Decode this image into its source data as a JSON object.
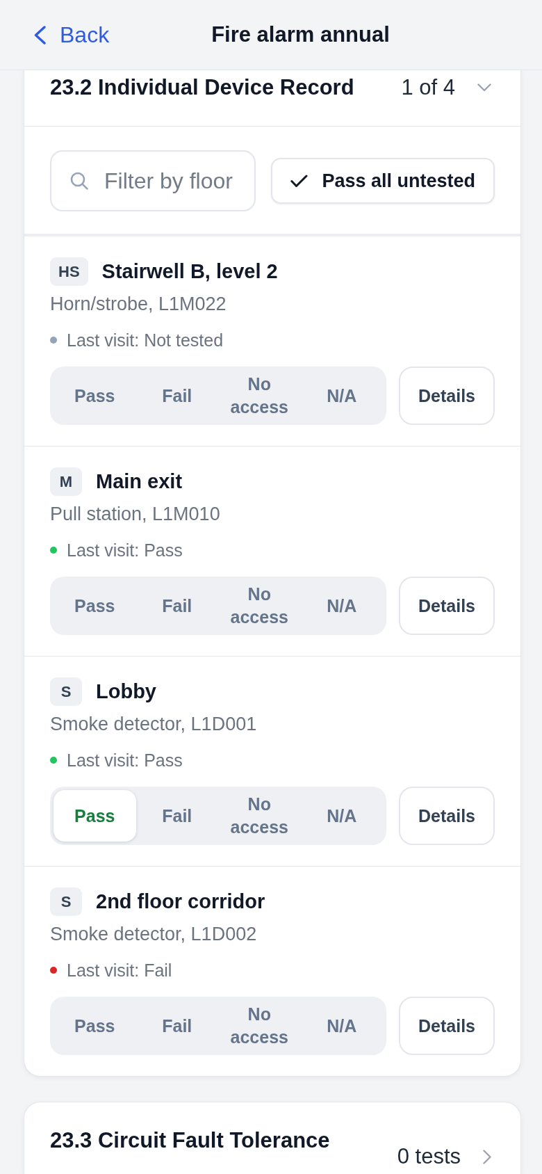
{
  "header": {
    "back_label": "Back",
    "title": "Fire alarm annual"
  },
  "sections": [
    {
      "title": "23.2 Individual Device Record",
      "count": "1 of 4",
      "expanded": true,
      "filter": {
        "placeholder": "Filter by floor"
      },
      "bulk_action": "Pass all untested",
      "devices": [
        {
          "badge": "HS",
          "name": "Stairwell B, level 2",
          "description": "Horn/strobe, L1M022",
          "last_visit": {
            "text": "Last visit: Not tested",
            "color": "#94a3b8"
          },
          "options": [
            {
              "label": "Pass",
              "selected": false
            },
            {
              "label": "Fail",
              "selected": false
            },
            {
              "label": "No access",
              "selected": false
            },
            {
              "label": "N/A",
              "selected": false
            }
          ],
          "details_label": "Details"
        },
        {
          "badge": "M",
          "name": "Main exit",
          "description": "Pull station, L1M010",
          "last_visit": {
            "text": "Last visit: Pass",
            "color": "#22c55e"
          },
          "options": [
            {
              "label": "Pass",
              "selected": false
            },
            {
              "label": "Fail",
              "selected": false
            },
            {
              "label": "No access",
              "selected": false
            },
            {
              "label": "N/A",
              "selected": false
            }
          ],
          "details_label": "Details"
        },
        {
          "badge": "S",
          "name": "Lobby",
          "description": "Smoke detector, L1D001",
          "last_visit": {
            "text": "Last visit: Pass",
            "color": "#22c55e"
          },
          "options": [
            {
              "label": "Pass",
              "selected": true
            },
            {
              "label": "Fail",
              "selected": false
            },
            {
              "label": "No access",
              "selected": false
            },
            {
              "label": "N/A",
              "selected": false
            }
          ],
          "details_label": "Details"
        },
        {
          "badge": "S",
          "name": "2nd floor corridor",
          "description": "Smoke detector, L1D002",
          "last_visit": {
            "text": "Last visit: Fail",
            "color": "#dc2626"
          },
          "options": [
            {
              "label": "Pass",
              "selected": false
            },
            {
              "label": "Fail",
              "selected": false
            },
            {
              "label": "No access",
              "selected": false
            },
            {
              "label": "N/A",
              "selected": false
            }
          ],
          "details_label": "Details"
        }
      ]
    },
    {
      "title": "23.3 Circuit Fault Tolerance",
      "count": "0 tests",
      "expanded": false
    }
  ]
}
